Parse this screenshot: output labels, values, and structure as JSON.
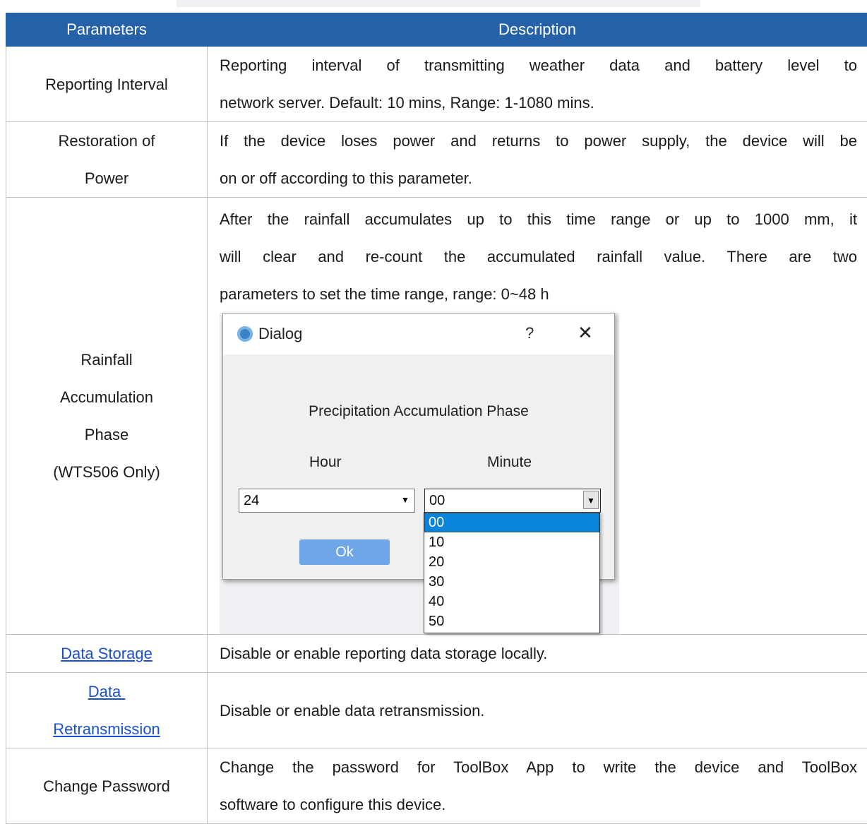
{
  "table": {
    "headers": {
      "param": "Parameters",
      "desc": "Description"
    },
    "rows": {
      "reporting_interval": {
        "name": "Reporting Interval",
        "desc_lines": [
          "Reporting interval of transmitting weather data and battery level to",
          "network server. Default: 10 mins, Range: 1-1080 mins."
        ]
      },
      "restoration": {
        "name_lines": [
          "Restoration of",
          "Power"
        ],
        "desc_lines": [
          "If the device loses power and returns to power supply, the device will be",
          "on or off according to this parameter."
        ]
      },
      "rainfall": {
        "name_lines": [
          "Rainfall",
          "Accumulation",
          "Phase",
          "(WTS506 Only)"
        ],
        "desc_lines": [
          "After the rainfall accumulates up to this time range or up to 1000 mm, it",
          "will clear and re-count the accumulated rainfall value. There are two",
          "parameters to set the time range, range: 0~48 h"
        ]
      },
      "data_storage": {
        "name": "Data Storage",
        "desc": "Disable or enable reporting data storage locally."
      },
      "data_retransmission": {
        "name_lines": [
          "Data ",
          "Retransmission"
        ],
        "desc": "Disable or enable data retransmission."
      },
      "change_password": {
        "name": "Change Password",
        "desc_lines": [
          "Change the password for ToolBox App to write the device and ToolBox",
          "software to configure this device."
        ]
      }
    }
  },
  "dialog": {
    "title": "Dialog",
    "help_glyph": "?",
    "close_glyph": "✕",
    "heading": "Precipitation Accumulation Phase",
    "hour_label": "Hour",
    "minute_label": "Minute",
    "hour_value": "24",
    "minute_value": "00",
    "ok_label": "Ok",
    "minute_options": [
      "00",
      "10",
      "20",
      "30",
      "40",
      "50"
    ],
    "selected_option_index": 0,
    "icon": "gear-icon"
  },
  "colors": {
    "header_bg": "#2461a8",
    "link": "#1a4fd0",
    "selection": "#0a84d8",
    "ok_button": "#6ea6e8"
  }
}
